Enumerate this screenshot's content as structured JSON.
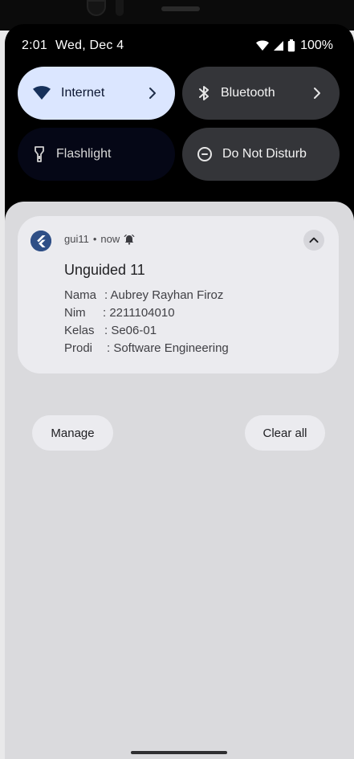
{
  "status_bar": {
    "time": "2:01",
    "date": "Wed, Dec 4",
    "battery": "100%",
    "icons": [
      "wifi-icon",
      "signal-icon",
      "battery-icon"
    ]
  },
  "quick_settings": [
    {
      "label": "Internet",
      "icon": "wifi-icon",
      "state": "on"
    },
    {
      "label": "Bluetooth",
      "icon": "bluetooth-icon",
      "state": "off"
    },
    {
      "label": "Flashlight",
      "icon": "flashlight-icon",
      "state": "unavailable"
    },
    {
      "label": "Do Not Disturb",
      "icon": "minus-circle-icon",
      "state": "off"
    }
  ],
  "notification": {
    "app_name": "gui11",
    "separator": "•",
    "timestamp": "now",
    "title": "Unguided 11",
    "details": [
      {
        "label": "Nama",
        "value": ": Aubrey Rayhan Firoz"
      },
      {
        "label": "Nim",
        "value": ": 2211104010"
      },
      {
        "label": "Kelas",
        "value": ": Se06-01"
      },
      {
        "label": "Prodi",
        "value": ": Software Engineering"
      }
    ],
    "icons": [
      "flutter-icon",
      "alarm-icon",
      "collapse-icon"
    ]
  },
  "actions": {
    "manage": "Manage",
    "clear_all": "Clear all"
  },
  "colors": {
    "shade_bg": "#dadadd",
    "card_bg": "#ebebef",
    "internet_tile": "#dbe6ff",
    "dark_tile": "#343539"
  }
}
